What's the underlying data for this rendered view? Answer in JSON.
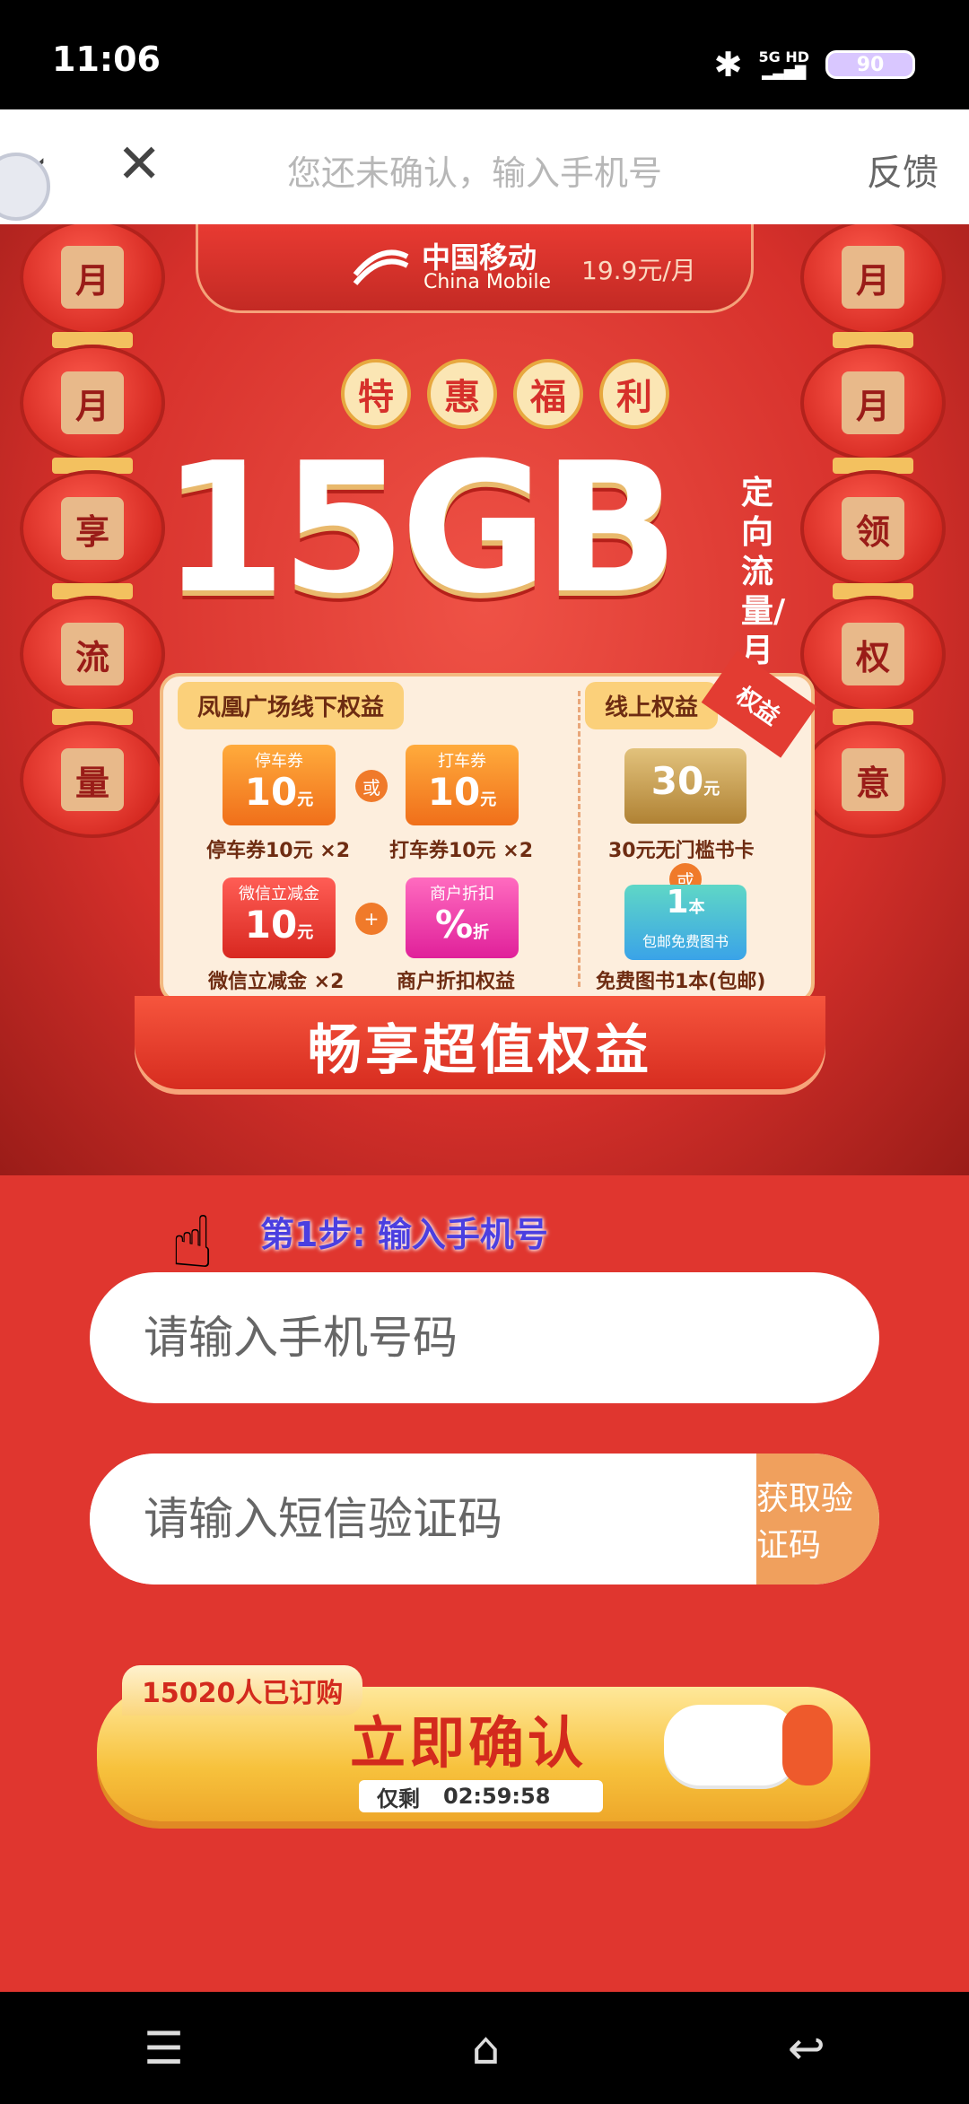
{
  "status_bar": {
    "time": "11:06",
    "network": "5G HD",
    "battery": "90"
  },
  "nav": {
    "title": "您还未确认，输入手机号",
    "feedback": "反馈"
  },
  "hero": {
    "brand_cn": "中国移动",
    "brand_en": "China Mobile",
    "price": "19.9元/月",
    "left_lanterns": [
      "月",
      "月",
      "享",
      "流",
      "量"
    ],
    "right_lanterns": [
      "月",
      "月",
      "领",
      "权",
      "意"
    ],
    "tehui": [
      "特",
      "惠",
      "福",
      "利"
    ],
    "big": "15GB",
    "side": "定向流量/月",
    "offline_title": "凤凰广场线下权益",
    "online_title": "线上权益",
    "ribbon": "权益",
    "coupons": [
      {
        "top": "停车券",
        "value": "10",
        "unit": "元",
        "caption": "停车券10元 ×2"
      },
      {
        "top": "打车券",
        "value": "10",
        "unit": "元",
        "caption": "打车券10元 ×2"
      },
      {
        "top": "微信立减金",
        "value": "10",
        "unit": "元",
        "caption": "微信立减金 ×2"
      },
      {
        "top": "商户折扣",
        "value": "%",
        "unit": "折",
        "caption": "商户折扣权益"
      }
    ],
    "or1": "或",
    "plus": "+",
    "online_card": {
      "value": "30",
      "unit": "元",
      "caption": "30元无门槛书卡"
    },
    "or2": "或",
    "book": {
      "value": "1",
      "unit": "本",
      "sub": "包邮免费图书",
      "caption": "免费图书1本(包邮)"
    },
    "banner": "畅享超值权益"
  },
  "step": {
    "label": "第1步: 输入手机号"
  },
  "phone": {
    "placeholder": "请输入手机号码"
  },
  "sms": {
    "placeholder": "请输入短信验证码",
    "button": "获取验证码"
  },
  "confirm": {
    "subscribed": "15020人已订购",
    "label": "立即确认",
    "remaining_label": "仅剩",
    "countdown": "02:59:58"
  },
  "bottom_nav": {
    "menu": "☰",
    "home": "⌂",
    "back": "↩"
  }
}
